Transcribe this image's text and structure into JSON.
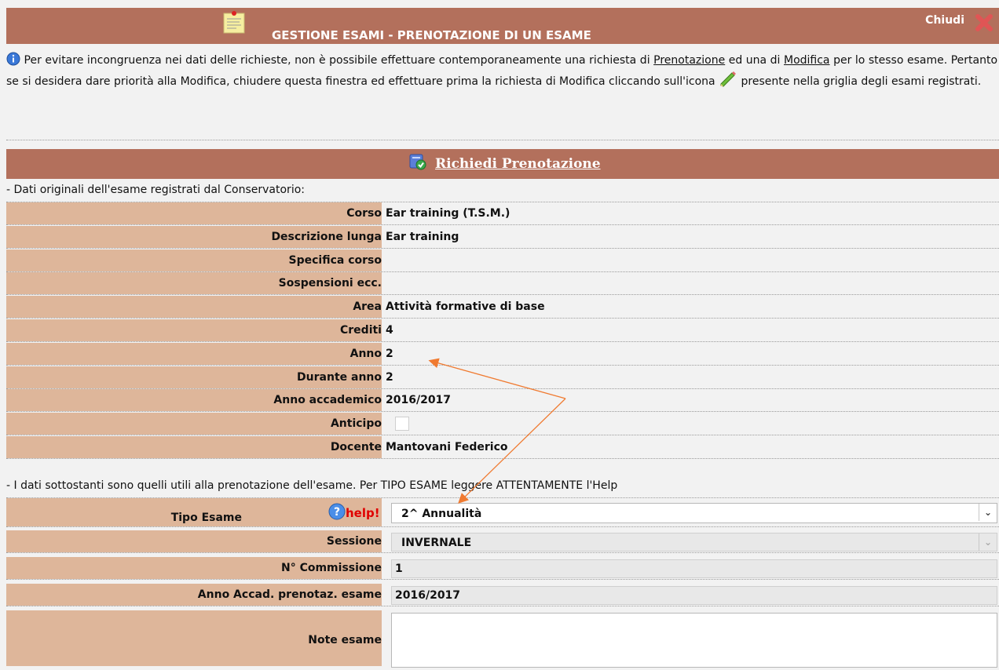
{
  "window": {
    "title": "GESTIONE ESAMI - PRENOTAZIONE DI UN ESAME",
    "close_label": "Chiudi"
  },
  "info": {
    "part1": " Per evitare incongruenza nei dati delle richieste, non è possibile effettuare contemporaneamente una richiesta di ",
    "link1": "Prenotazione",
    "part2": " ed una di ",
    "link2": "Modifica",
    "part3": " per lo stesso esame. Pertanto se si desidera dare priorità alla Modifica, chiudere questa finestra ed effettuare prima la richiesta di Modifica cliccando sull'icona ",
    "part4": " presente nella griglia degli esami registrati."
  },
  "section": {
    "title": "Richiedi Prenotazione"
  },
  "caption_original": "- Dati originali dell'esame registrati dal Conservatorio:",
  "original": [
    {
      "label": "Corso",
      "value": "Ear training (T.S.M.)"
    },
    {
      "label": "Descrizione lunga",
      "value": "Ear training"
    },
    {
      "label": "Specifica corso",
      "value": ""
    },
    {
      "label": "Sospensioni ecc.",
      "value": ""
    },
    {
      "label": "Area",
      "value": "Attività formative di base"
    },
    {
      "label": "Crediti",
      "value": "4"
    },
    {
      "label": "Anno",
      "value": "2"
    },
    {
      "label": "Durante anno",
      "value": "2"
    },
    {
      "label": "Anno accademico",
      "value": "2016/2017"
    },
    {
      "label": "Anticipo",
      "value": ""
    },
    {
      "label": "Docente",
      "value": "Mantovani Federico"
    }
  ],
  "caption_booking": "- I dati sottostanti sono quelli utili alla prenotazione dell'esame. Per TIPO ESAME leggere ATTENTAMENTE l'Help",
  "booking": {
    "tipo_label": "Tipo Esame",
    "help_label": "help!",
    "tipo_value": "2^ Annualità",
    "sessione_label": "Sessione",
    "sessione_value": "INVERNALE",
    "commissione_label": "N° Commissione",
    "commissione_value": "1",
    "anno_label": "Anno Accad. prenotaz. esame",
    "anno_value": "2016/2017",
    "note_label": "Note esame",
    "note_value": ""
  },
  "colors": {
    "header": "#b3705c",
    "label_bg": "#deb69a",
    "page_bg": "#f2f2f2",
    "annotation": "#f07a30"
  }
}
